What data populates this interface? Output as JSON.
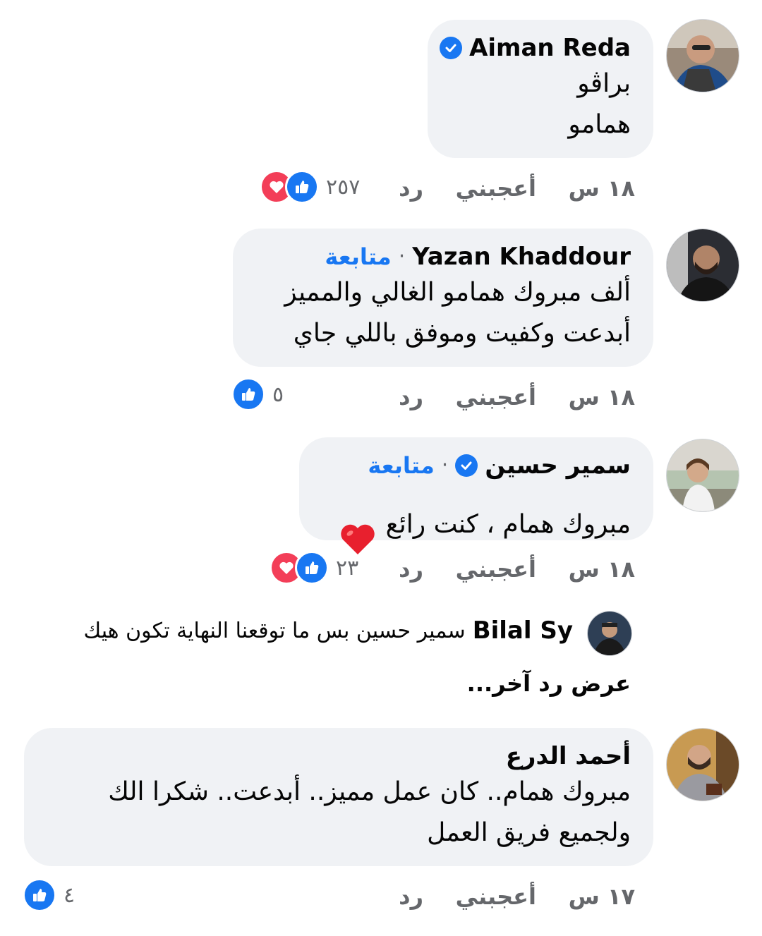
{
  "comments": [
    {
      "name": "Aiman Reda",
      "verified": true,
      "follow": "",
      "body": "براڤو\nهمامو",
      "time": "١٨ س",
      "like_label": "أعجبني",
      "reply_label": "رد",
      "reaction_count": "٢٥٧",
      "reactions": [
        "like",
        "love"
      ]
    },
    {
      "name": "Yazan Khaddour",
      "verified": false,
      "follow": "متابعة",
      "separator": "·",
      "body": "ألف مبروك همامو الغالي والمميز\nأبدعت وكفيت وموفق باللي جاي",
      "time": "١٨ س",
      "like_label": "أعجبني",
      "reply_label": "رد",
      "reaction_count": "٥",
      "reactions": [
        "like"
      ]
    },
    {
      "name": "سمير حسين",
      "verified": true,
      "follow": "متابعة",
      "separator": "·",
      "body": "مبروك همام ، كنت رائع",
      "time": "١٨ س",
      "like_label": "أعجبني",
      "reply_label": "رد",
      "reaction_count": "٢٣",
      "reactions": [
        "like",
        "love"
      ]
    },
    {
      "name": "أحمد الدرع",
      "verified": false,
      "follow": "",
      "body": "مبروك همام.. كان عمل مميز.. أبدعت.. شكرا الك\nولجميع فريق العمل",
      "time": "١٧ س",
      "like_label": "أعجبني",
      "reply_label": "رد",
      "reaction_count": "٤",
      "reactions": [
        "like"
      ]
    }
  ],
  "reply_preview": {
    "name": "Bilal Sy",
    "text": "سمير حسين بس ما توقعنا النهاية تكون هيك"
  },
  "view_more_replies": "عرض رد آخر...",
  "colors": {
    "bubble": "#f0f2f5",
    "meta_text": "#65676b",
    "accent": "#1877f2",
    "love": "#f33e58"
  }
}
